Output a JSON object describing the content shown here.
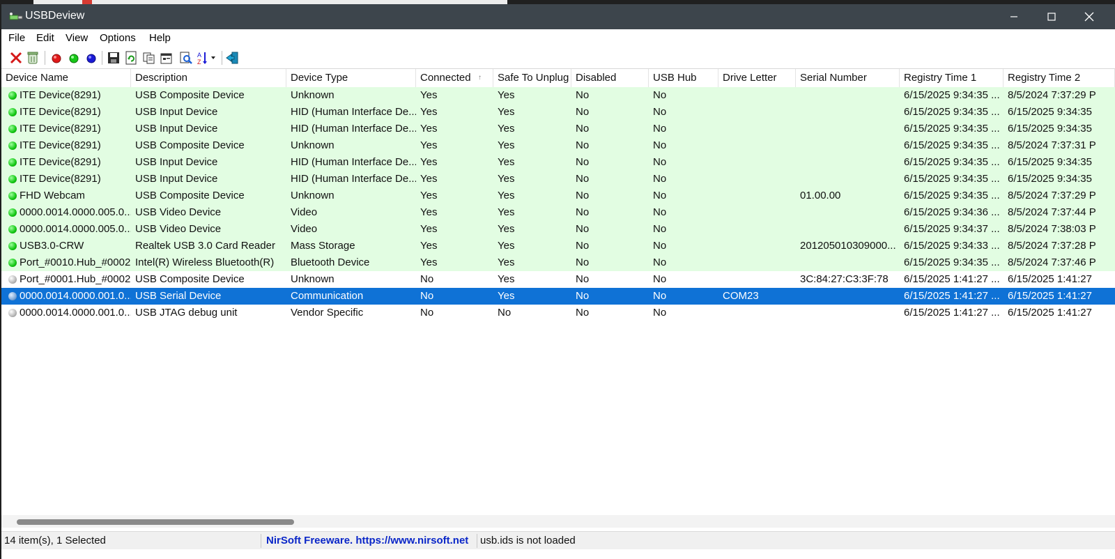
{
  "window": {
    "title": "USBDeview",
    "minimize": "–",
    "close": "✕"
  },
  "menu": [
    "File",
    "Edit",
    "View",
    "Options",
    "Help"
  ],
  "toolbar_icons": [
    "disconnect-icon",
    "uninstall-icon",
    "disable-icon",
    "enable-icon",
    "enable-disable-icon",
    "save-icon",
    "refresh-icon",
    "copy-icon",
    "properties-icon",
    "find-icon",
    "sort-icon",
    "exit-icon"
  ],
  "columns": [
    {
      "label": "Device Name"
    },
    {
      "label": "Description"
    },
    {
      "label": "Device Type"
    },
    {
      "label": "Connected",
      "sort": "↑"
    },
    {
      "label": "Safe To Unplug"
    },
    {
      "label": "Disabled"
    },
    {
      "label": "USB Hub"
    },
    {
      "label": "Drive Letter"
    },
    {
      "label": "Serial Number"
    },
    {
      "label": "Registry Time 1"
    },
    {
      "label": "Registry Time 2"
    }
  ],
  "rows": [
    {
      "status": "green",
      "cells": [
        "ITE Device(8291)",
        "USB Composite Device",
        "Unknown",
        "Yes",
        "Yes",
        "No",
        "No",
        "",
        "",
        "6/15/2025 9:34:35 ...",
        "8/5/2024 7:37:29 P"
      ]
    },
    {
      "status": "green",
      "cells": [
        "ITE Device(8291)",
        "USB Input Device",
        "HID (Human Interface De...",
        "Yes",
        "Yes",
        "No",
        "No",
        "",
        "",
        "6/15/2025 9:34:35 ...",
        "6/15/2025 9:34:35"
      ]
    },
    {
      "status": "green",
      "cells": [
        "ITE Device(8291)",
        "USB Input Device",
        "HID (Human Interface De...",
        "Yes",
        "Yes",
        "No",
        "No",
        "",
        "",
        "6/15/2025 9:34:35 ...",
        "6/15/2025 9:34:35"
      ]
    },
    {
      "status": "green",
      "cells": [
        "ITE Device(8291)",
        "USB Composite Device",
        "Unknown",
        "Yes",
        "Yes",
        "No",
        "No",
        "",
        "",
        "6/15/2025 9:34:35 ...",
        "8/5/2024 7:37:31 P"
      ]
    },
    {
      "status": "green",
      "cells": [
        "ITE Device(8291)",
        "USB Input Device",
        "HID (Human Interface De...",
        "Yes",
        "Yes",
        "No",
        "No",
        "",
        "",
        "6/15/2025 9:34:35 ...",
        "6/15/2025 9:34:35"
      ]
    },
    {
      "status": "green",
      "cells": [
        "ITE Device(8291)",
        "USB Input Device",
        "HID (Human Interface De...",
        "Yes",
        "Yes",
        "No",
        "No",
        "",
        "",
        "6/15/2025 9:34:35 ...",
        "6/15/2025 9:34:35"
      ]
    },
    {
      "status": "green",
      "cells": [
        "FHD Webcam",
        "USB Composite Device",
        "Unknown",
        "Yes",
        "Yes",
        "No",
        "No",
        "",
        "01.00.00",
        "6/15/2025 9:34:35 ...",
        "8/5/2024 7:37:29 P"
      ]
    },
    {
      "status": "green",
      "cells": [
        "0000.0014.0000.005.0...",
        "USB Video Device",
        "Video",
        "Yes",
        "Yes",
        "No",
        "No",
        "",
        "",
        "6/15/2025 9:34:36 ...",
        "8/5/2024 7:37:44 P"
      ]
    },
    {
      "status": "green",
      "cells": [
        "0000.0014.0000.005.0...",
        "USB Video Device",
        "Video",
        "Yes",
        "Yes",
        "No",
        "No",
        "",
        "",
        "6/15/2025 9:34:37 ...",
        "8/5/2024 7:38:03 P"
      ]
    },
    {
      "status": "green",
      "cells": [
        "USB3.0-CRW",
        "Realtek USB 3.0 Card Reader",
        "Mass Storage",
        "Yes",
        "Yes",
        "No",
        "No",
        "",
        "201205010309000...",
        "6/15/2025 9:34:33 ...",
        "8/5/2024 7:37:28 P"
      ]
    },
    {
      "status": "green",
      "cells": [
        "Port_#0010.Hub_#0002",
        "Intel(R) Wireless Bluetooth(R)",
        "Bluetooth Device",
        "Yes",
        "Yes",
        "No",
        "No",
        "",
        "",
        "6/15/2025 9:34:35 ...",
        "8/5/2024 7:37:46 P"
      ]
    },
    {
      "status": "gray",
      "cells": [
        "Port_#0001.Hub_#0002",
        "USB Composite Device",
        "Unknown",
        "No",
        "Yes",
        "No",
        "No",
        "",
        "3C:84:27:C3:3F:78",
        "6/15/2025 1:41:27 ...",
        "6/15/2025 1:41:27"
      ]
    },
    {
      "status": "blue",
      "selected": true,
      "cells": [
        "0000.0014.0000.001.0...",
        "USB Serial Device",
        "Communication",
        "No",
        "Yes",
        "No",
        "No",
        "COM23",
        "",
        "6/15/2025 1:41:27 ...",
        "6/15/2025 1:41:27"
      ]
    },
    {
      "status": "gray",
      "cells": [
        "0000.0014.0000.001.0...",
        "USB JTAG debug unit",
        "Vendor Specific",
        "No",
        "No",
        "No",
        "No",
        "",
        "",
        "6/15/2025 1:41:27 ...",
        "6/15/2025 1:41:27"
      ]
    }
  ],
  "status": {
    "count": "14 item(s), 1 Selected",
    "vendor": "NirSoft Freeware.  https://www.nirsoft.net",
    "ids": "usb.ids is not loaded"
  }
}
